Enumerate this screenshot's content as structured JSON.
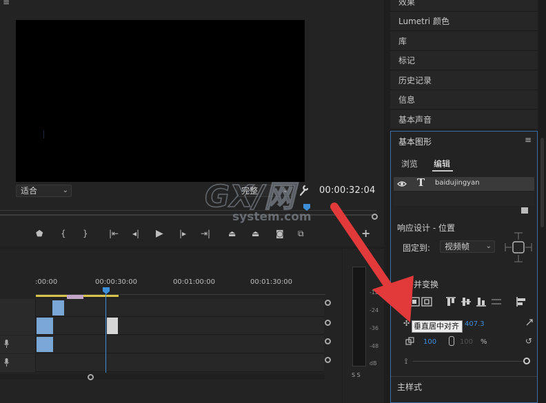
{
  "monitor": {
    "top_icon": "≡",
    "fit_select": "适合",
    "quality_select": "完整",
    "timecode": "00:00:32:04"
  },
  "panels": [
    {
      "label": "效果"
    },
    {
      "label": "Lumetri 颜色"
    },
    {
      "label": "库"
    },
    {
      "label": "标记"
    },
    {
      "label": "历史记录"
    },
    {
      "label": "信息"
    },
    {
      "label": "基本声音"
    }
  ],
  "essential_graphics": {
    "title": "基本图形",
    "menu": "≡",
    "tabs": {
      "browse": "浏览",
      "edit": "编辑"
    },
    "layer_name": "baidujingyan",
    "text_type_glyph": "T",
    "responsive_label": "响应设计 - 位置",
    "pin_label": "固定到:",
    "pin_value": "视频帧",
    "align_title": "对齐并变换",
    "tooltip": "垂直居中对齐",
    "position_y": "407.3",
    "scale": "100",
    "scale_secondary": "100",
    "percent": "%",
    "bottom_label": "主样式"
  },
  "timeline": {
    "ruler": [
      ":00:00",
      "00:00:30:00",
      "00:01:00:00",
      "00:01:30:00"
    ]
  },
  "meter": {
    "labels": [
      "-12",
      "-24",
      "-36",
      "-48",
      "dB"
    ],
    "solo": "S S"
  },
  "watermark": {
    "brand": "GX/网",
    "domain": "system.com"
  },
  "colors": {
    "accent_blue": "#3c8fd8",
    "clip_blue": "#7aa7d6",
    "arrow_red": "#e23a3a",
    "inout_yellow": "#d9c24a"
  }
}
